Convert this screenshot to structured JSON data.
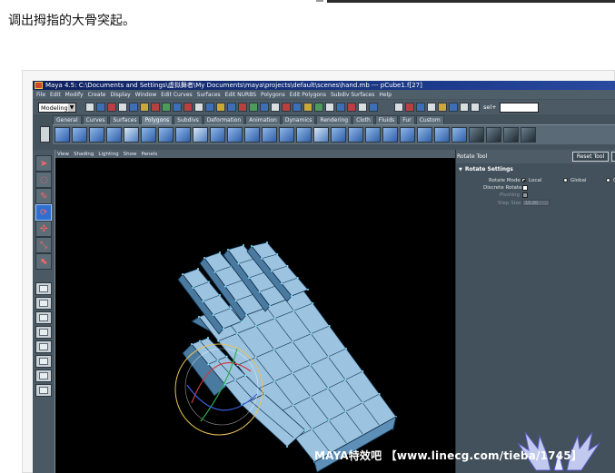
{
  "caption": "调出拇指的大骨突起。",
  "maya": {
    "window_title": "Maya 4.5: C:\\Documents and Settings\\虚拟舞者\\My Documents\\maya\\projects\\default\\scenes\\hand.mb  ---  pCube1.f[27]",
    "menus": [
      "File",
      "Edit",
      "Modify",
      "Create",
      "Display",
      "Window",
      "Edit Curves",
      "Surfaces",
      "Edit NURBS",
      "Polygons",
      "Edit Polygons",
      "Subdiv Surfaces",
      "Help"
    ],
    "mode": "Modeling",
    "select_label": "sel+",
    "shelf_tabs": [
      "General",
      "Curves",
      "Surfaces",
      "Polygons",
      "Subdivs",
      "Deformation",
      "Animation",
      "Dynamics",
      "Rendering",
      "Cloth",
      "Fluids",
      "Fur",
      "Custom"
    ],
    "active_shelf_tab": "Polygons",
    "panel_menus": [
      "View",
      "Shading",
      "Lighting",
      "Show",
      "Panels"
    ],
    "tool_settings": {
      "title": "Rotate Tool",
      "reset_label": "Reset Tool",
      "section": "Rotate Settings",
      "rotate_mode_label": "Rotate Mode",
      "modes": [
        "Local",
        "Global",
        "G"
      ],
      "selected_mode": "Local",
      "discrete_label": "Discrete Rotate",
      "pivot_label": "Pivoting",
      "step_label": "Step Size",
      "step_value": "15.00"
    }
  },
  "watermark": "MAYA特效吧 【www.linecg.com/tieba/1745】",
  "colors": {
    "mesh_fill": "#8fb7d7",
    "mesh_edge": "#0c2e48",
    "vertex": "#7fe3ff",
    "selection_ring": "#e6c35a"
  }
}
